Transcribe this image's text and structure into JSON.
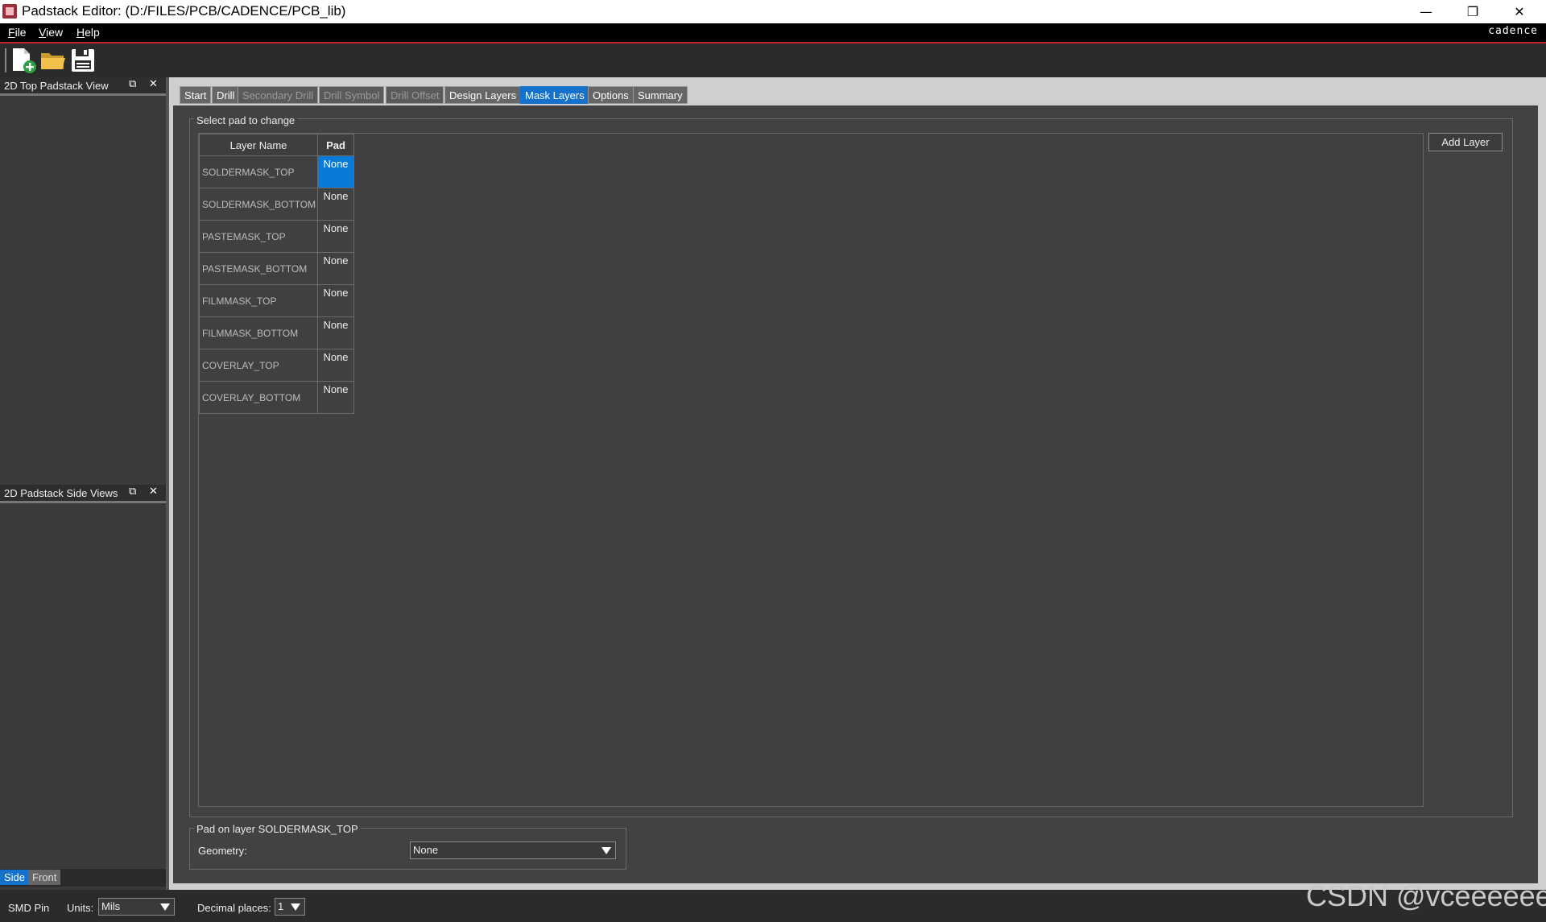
{
  "window": {
    "title": "Padstack Editor:  (D:/FILES/PCB/CADENCE/PCB_lib)",
    "minimize": "—",
    "restore": "❐",
    "close": "✕"
  },
  "menu": {
    "items": [
      {
        "accel": "F",
        "rest": "ile"
      },
      {
        "accel": "V",
        "rest": "iew"
      },
      {
        "accel": "H",
        "rest": "elp"
      }
    ],
    "brand": "cadence"
  },
  "toolbar": {
    "icons": [
      "new-file-icon",
      "open-folder-icon",
      "save-disk-icon"
    ]
  },
  "panels": {
    "top_view": {
      "title": "2D Top Padstack View",
      "float_icon": "⧉",
      "close_icon": "✕"
    },
    "side_view": {
      "title": "2D Padstack Side Views",
      "float_icon": "⧉",
      "close_icon": "✕"
    },
    "view_tabs": [
      "Side",
      "Front"
    ]
  },
  "tabs": [
    {
      "label": "Start",
      "state": "normal"
    },
    {
      "label": "Drill",
      "state": "normal"
    },
    {
      "label": "Secondary Drill",
      "state": "disabled"
    },
    {
      "label": "Drill Symbol",
      "state": "disabled"
    },
    {
      "label": "Drill Offset",
      "state": "disabled"
    },
    {
      "label": "Design Layers",
      "state": "normal"
    },
    {
      "label": "Mask Layers",
      "state": "active"
    },
    {
      "label": "Options",
      "state": "normal"
    },
    {
      "label": "Summary",
      "state": "normal"
    }
  ],
  "select_pad": {
    "group_title": "Select pad to change",
    "table": {
      "headers": [
        "Layer Name",
        "Pad"
      ],
      "rows": [
        {
          "layer": "SOLDERMASK_TOP",
          "pad": "None"
        },
        {
          "layer": "SOLDERMASK_BOTTOM",
          "pad": "None"
        },
        {
          "layer": "PASTEMASK_TOP",
          "pad": "None"
        },
        {
          "layer": "PASTEMASK_BOTTOM",
          "pad": "None"
        },
        {
          "layer": "FILMMASK_TOP",
          "pad": "None"
        },
        {
          "layer": "FILMMASK_BOTTOM",
          "pad": "None"
        },
        {
          "layer": "COVERLAY_TOP",
          "pad": "None"
        },
        {
          "layer": "COVERLAY_BOTTOM",
          "pad": "None"
        }
      ]
    },
    "add_layer_label": "Add Layer"
  },
  "pad_on_layer": {
    "group_title": "Pad on layer SOLDERMASK_TOP",
    "geometry_label": "Geometry:",
    "geometry_value": "None"
  },
  "statusbar": {
    "pad_type": "SMD Pin",
    "units_label": "Units:",
    "units_value": "Mils",
    "decimal_label": "Decimal places:",
    "decimal_value": "1"
  },
  "watermark": "CSDN @vceeeeee",
  "colors": {
    "accent": "#1472cc",
    "selected_cell": "#0a7ad8",
    "menubar_rule": "#c0212b"
  }
}
